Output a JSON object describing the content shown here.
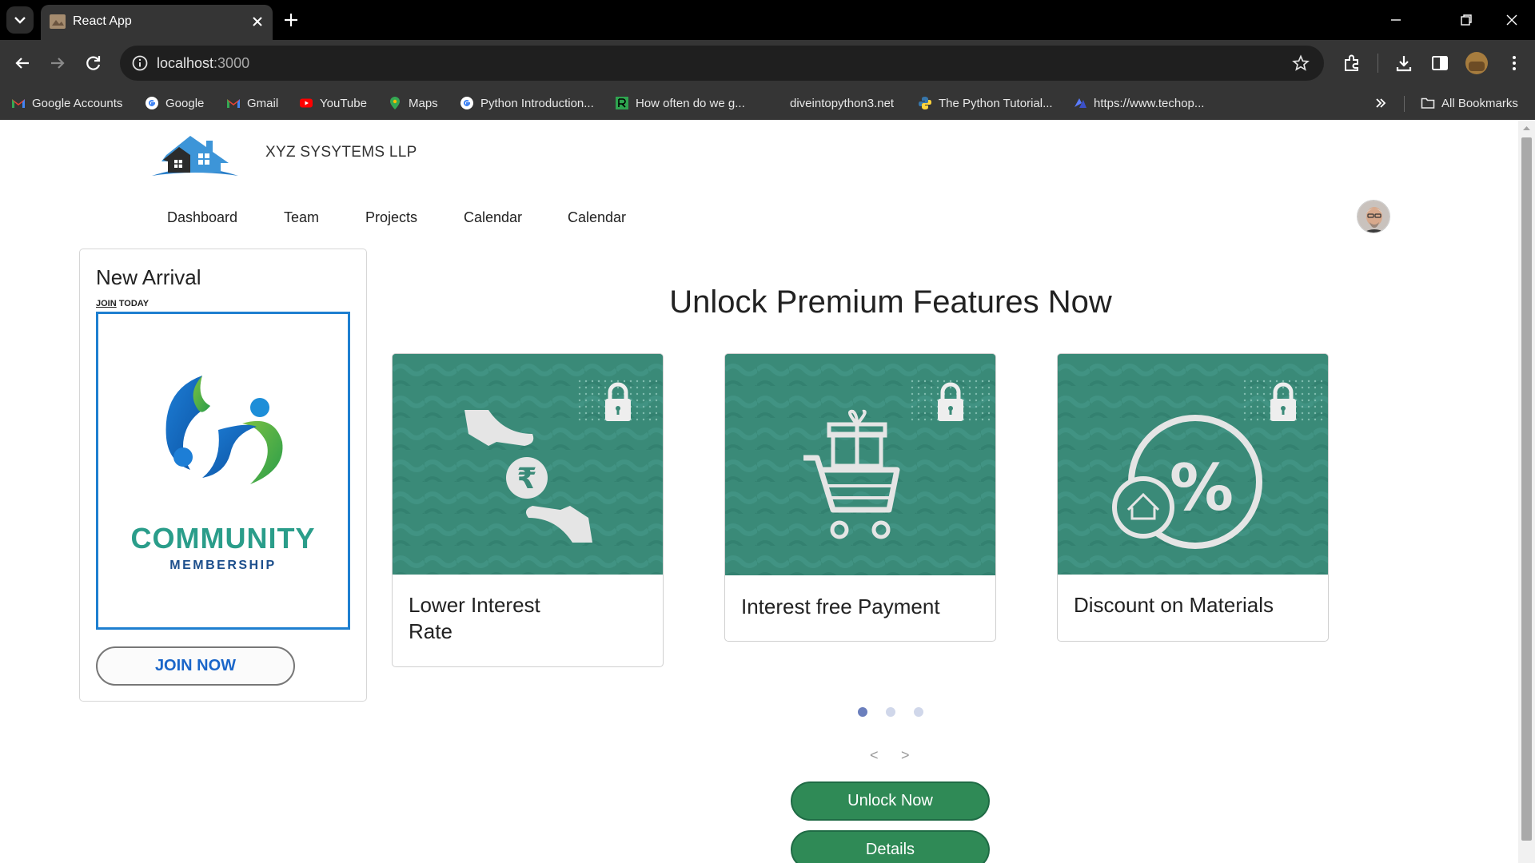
{
  "browser": {
    "tab_title": "React App",
    "url_host": "localhost",
    "url_port": ":3000",
    "bookmarks": [
      {
        "label": "Google Accounts",
        "icon": "gmail-icon"
      },
      {
        "label": "Google",
        "icon": "google-icon"
      },
      {
        "label": "Gmail",
        "icon": "gmail-icon"
      },
      {
        "label": "YouTube",
        "icon": "youtube-icon"
      },
      {
        "label": "Maps",
        "icon": "maps-icon"
      },
      {
        "label": "Python Introduction...",
        "icon": "google-icon"
      },
      {
        "label": "How often do we g...",
        "icon": "site-icon"
      },
      {
        "label": "diveintopython3.net",
        "icon": ""
      },
      {
        "label": "The Python Tutorial...",
        "icon": "python-icon"
      },
      {
        "label": "https://www.techop...",
        "icon": "site-icon"
      }
    ],
    "all_bookmarks": "All Bookmarks"
  },
  "header": {
    "company": "XYZ SYSYTEMS LLP",
    "nav": [
      "Dashboard",
      "Team",
      "Projects",
      "Calendar",
      "Calendar"
    ]
  },
  "arrival": {
    "title": "New Arrival",
    "sub_join": "JOIN",
    "sub_today": " TODAY",
    "image_title": "COMMUNITY",
    "image_sub": "MEMBERSHIP",
    "join_button": "JOIN NOW"
  },
  "premium": {
    "title": "Unlock Premium Features Now",
    "features": [
      {
        "label": "Lower Interest Rate",
        "icon": "rupee-hands-icon"
      },
      {
        "label": "Interest free Payment",
        "icon": "gift-cart-icon"
      },
      {
        "label": "Discount on Materials",
        "icon": "percent-discount-icon"
      }
    ],
    "carousel_active": 1,
    "carousel_count": 3,
    "prev": "<",
    "next": ">",
    "unlock_button": "Unlock Now",
    "details_button": "Details"
  },
  "colors": {
    "feature_bg": "#3a8a78",
    "button_green": "#2f8a56",
    "join_blue": "#1a66c9"
  }
}
